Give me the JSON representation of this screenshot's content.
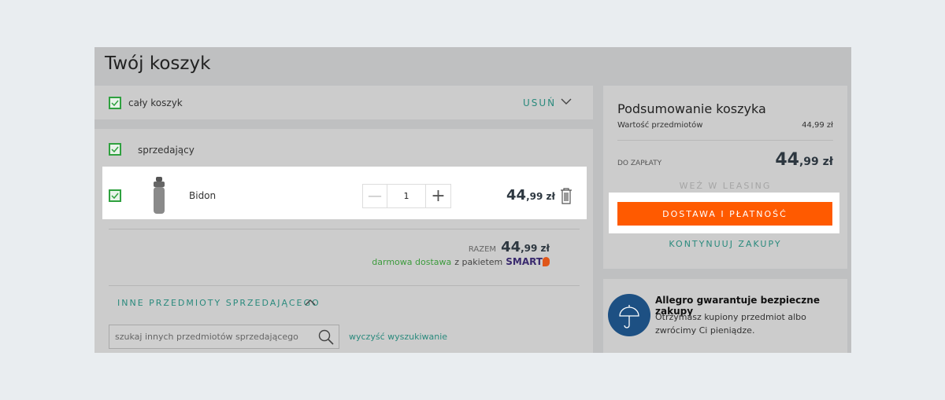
{
  "title": "Twój koszyk",
  "cart_all": {
    "label": "cały koszyk",
    "remove": "USUŃ"
  },
  "seller": {
    "label": "sprzedający"
  },
  "item": {
    "name": "Bidon",
    "quantity": "1",
    "price_int": "44",
    "price_dec": ",99 zł"
  },
  "seller_total": {
    "label": "RAZEM",
    "price_int": "44",
    "price_dec": ",99 zł",
    "free_delivery": "darmowa dostawa",
    "with_package": "z pakietem",
    "smart": "SMART"
  },
  "other_items": {
    "label": "INNE PRZEDMIOTY SPRZEDAJĄCEGO",
    "search_placeholder": "szukaj innych przedmiotów sprzedającego",
    "clear": "wyczyść wyszukiwanie"
  },
  "summary": {
    "title": "Podsumowanie koszyka",
    "items_value_label": "Wartość przedmiotów",
    "items_value": "44,99 zł",
    "to_pay_label": "DO ZAPŁATY",
    "to_pay_int": "44",
    "to_pay_dec": ",99 zł",
    "leasing": "WEŹ W LEASING",
    "checkout": "DOSTAWA I PŁATNOŚĆ",
    "continue": "KONTYNUUJ ZAKUPY"
  },
  "guarantee": {
    "title": "Allegro gwarantuje bezpieczne zakupy",
    "text": "Otrzymasz kupiony przedmiot albo zwrócimy Ci pieniądze."
  },
  "colors": {
    "accent": "#ff5a00",
    "teal": "#2a8a7d",
    "check": "#2fa13f",
    "guarantee_circle": "#1d5083"
  }
}
